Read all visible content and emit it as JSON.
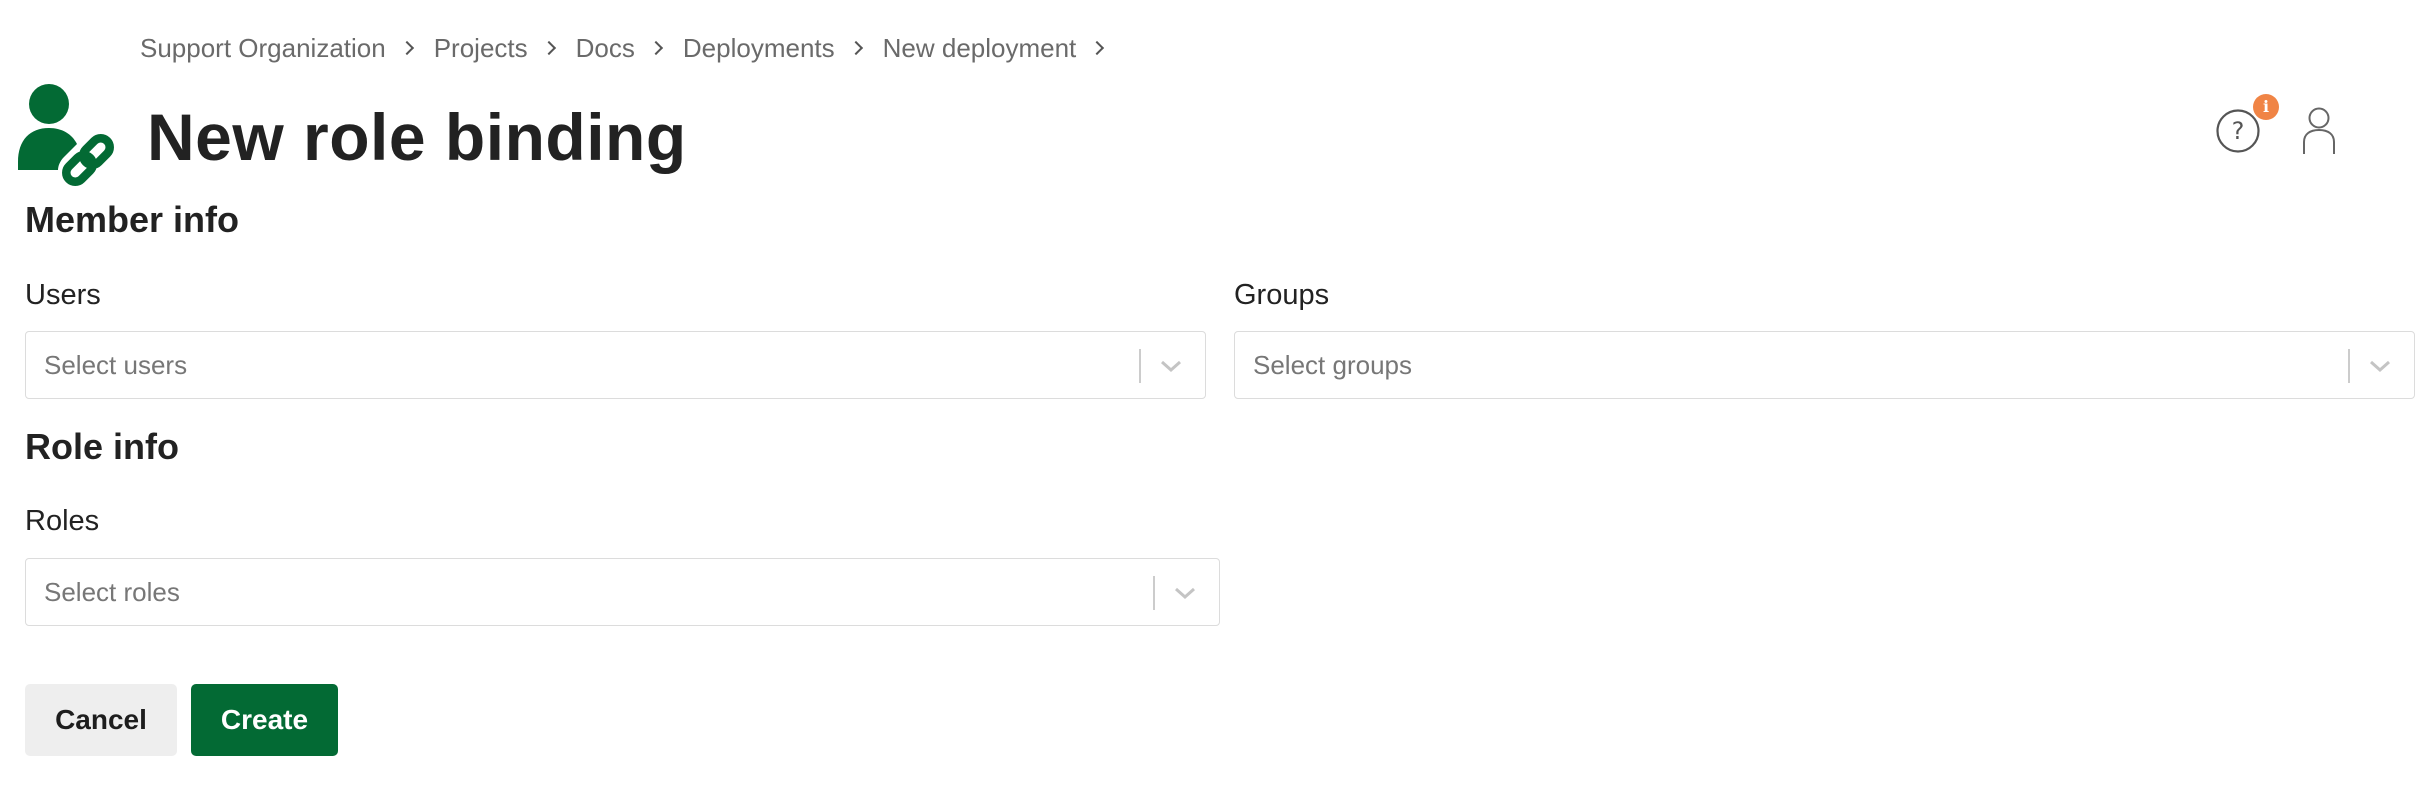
{
  "breadcrumb": [
    {
      "label": "Support Organization"
    },
    {
      "label": "Projects"
    },
    {
      "label": "Docs"
    },
    {
      "label": "Deployments"
    },
    {
      "label": "New deployment"
    }
  ],
  "header": {
    "title": "New role binding",
    "icon": "user-link-icon",
    "help_badge": "i"
  },
  "member_info": {
    "heading": "Member info",
    "users": {
      "label": "Users",
      "placeholder": "Select users"
    },
    "groups": {
      "label": "Groups",
      "placeholder": "Select groups"
    }
  },
  "role_info": {
    "heading": "Role info",
    "roles": {
      "label": "Roles",
      "placeholder": "Select roles"
    }
  },
  "actions": {
    "cancel_label": "Cancel",
    "create_label": "Create"
  },
  "colors": {
    "accent": "#036a34",
    "badge": "#f08445",
    "secondary_button": "#eeeeee"
  }
}
